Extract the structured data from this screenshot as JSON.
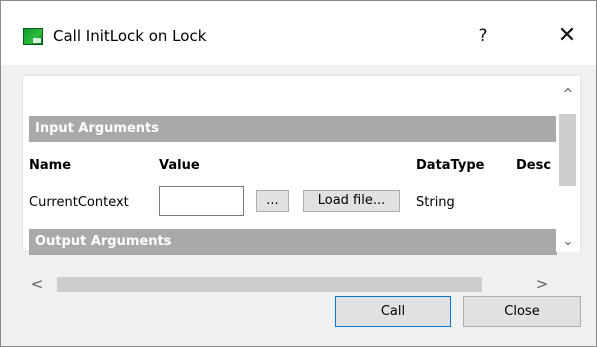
{
  "window": {
    "title": "Call InitLock on Lock",
    "help_glyph": "?",
    "close_glyph": "✕"
  },
  "input_section": {
    "title": "Input Arguments",
    "columns": [
      "Name",
      "Value",
      "DataType",
      "Desc"
    ],
    "rows": [
      {
        "name": "CurrentContext",
        "value": "",
        "browse_label": "...",
        "load_label": "Load file...",
        "data_type": "String"
      }
    ]
  },
  "output_section": {
    "title": "Output Arguments"
  },
  "scroll": {
    "up_glyph": "^",
    "down_glyph": "⌄",
    "left_glyph": "<",
    "right_glyph": ">"
  },
  "buttons": {
    "call_label": "Call",
    "close_label": "Close"
  },
  "colors": {
    "section_bar": "#a9a9a9",
    "dialog_bg": "#f0f0f0",
    "focus_border": "#0078d7"
  },
  "icons": [
    "app-icon",
    "help-icon",
    "close-icon"
  ]
}
